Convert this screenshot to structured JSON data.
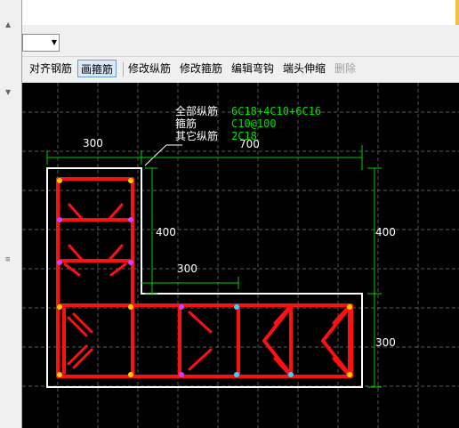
{
  "toolbar": {
    "align_rebar": "对齐钢筋",
    "draw_stirrup": "画箍筋",
    "modify_long_rebar": "修改纵筋",
    "modify_stirrup": "修改箍筋",
    "edit_hook": "编辑弯钩",
    "end_extension": "端头伸缩",
    "delete": "删除"
  },
  "drawing": {
    "label_all_long": "全部纵筋",
    "value_all_long": "6C18+4C10+6C16",
    "label_stirrup": "箍筋",
    "value_stirrup": "C10@100",
    "label_other_long": "其它纵筋",
    "value_other_long": "2C18",
    "dim_top_300": "300",
    "dim_top_700": "700",
    "dim_left_400": "400",
    "dim_mid_300": "300",
    "dim_right_400": "400",
    "dim_right_300": "300"
  },
  "colors": {
    "canvas_bg": "#000000",
    "rebar": "#ff0000",
    "dimension": "#00e000",
    "outline": "#ffffff",
    "grid": "#808080"
  }
}
